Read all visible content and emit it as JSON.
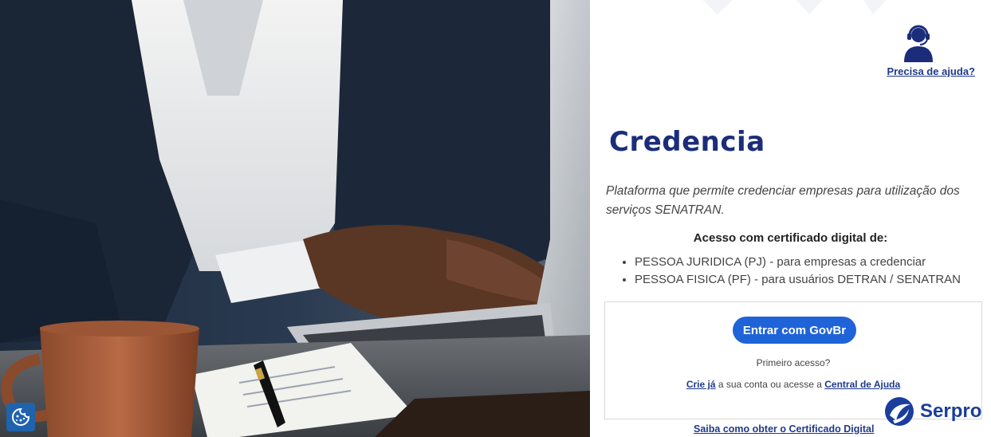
{
  "help": {
    "link_label": "Precisa de ajuda?"
  },
  "app": {
    "title": "Credencia",
    "subtitle": "Plataforma que permite credenciar empresas para utilização dos serviços SENATRAN."
  },
  "access": {
    "title": "Acesso com certificado digital de:",
    "items": [
      "PESSOA JURIDICA (PJ) - para empresas a credenciar",
      "PESSOA FISICA (PF) - para usuários DETRAN / SENATRAN"
    ]
  },
  "login": {
    "govbr_button": "Entrar com GovBr",
    "first_access": "Primeiro acesso?",
    "create_link": "Crie já",
    "create_middle": " a sua conta ou acesse a ",
    "help_center_link": "Central de Ajuda"
  },
  "footer": {
    "cert_link": "Saiba como obter o Certificado Digital",
    "brand": "Serpro"
  },
  "colors": {
    "primary": "#1b2d7a",
    "button": "#1f63d8",
    "brand": "#1b3e9c"
  },
  "icons": {
    "help": "headset-agent-icon",
    "cookie": "cookie-icon",
    "brand": "serpro-logo"
  }
}
